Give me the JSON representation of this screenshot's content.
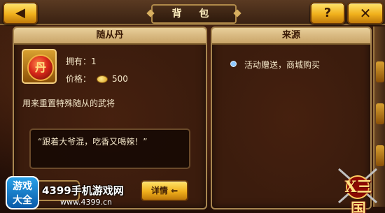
{
  "header": {
    "back_icon": "triangle-left-icon",
    "back_glyph": "◀",
    "title": "背 包",
    "help_glyph": "?",
    "close_glyph": "✕"
  },
  "item_panel": {
    "title": "随从丹",
    "own_label": "拥有：1",
    "price_label": "价格：",
    "price_value": "500",
    "icon": "red-pill-icon",
    "icon_glyph": "丹",
    "description": "用来重置特殊随从的武将",
    "quote": "“跟着大爷混，吃香又喝辣！”",
    "detail_button": "详情",
    "detail_arrow": "⇐"
  },
  "source_panel": {
    "title": "来源",
    "items": [
      "活动赠送，商城购买"
    ]
  },
  "watermark": {
    "logo_text_1": "游戏",
    "logo_text_2": "大全",
    "site_name": "4399手机游戏网",
    "site_url": "www.4399.cn",
    "game_logo_text": "X三国"
  },
  "colors": {
    "gold_button": "#f0b01c",
    "panel_bg": "#3b1c0d",
    "panel_border": "#a88650",
    "header_bg": "#e8cf9a",
    "text": "#f3e6c8"
  }
}
